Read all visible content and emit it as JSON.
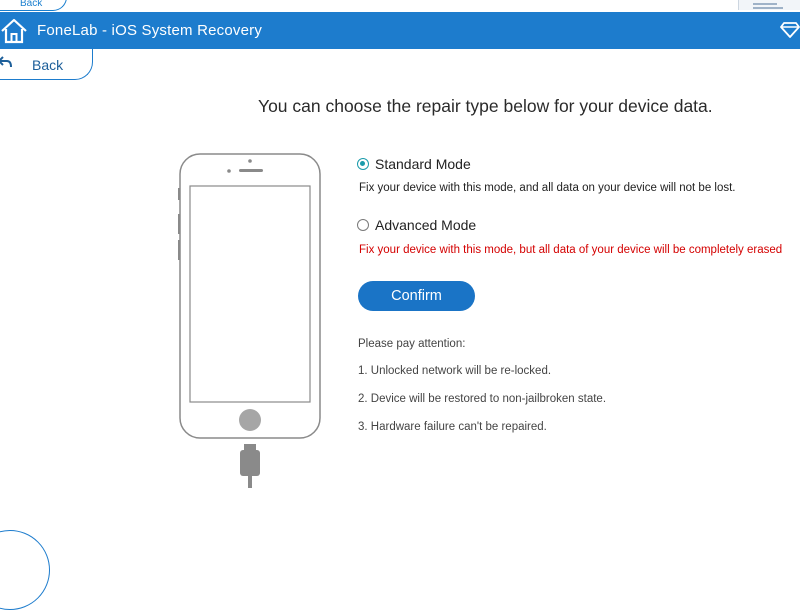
{
  "ghost": {
    "back_label": "Back"
  },
  "titlebar": {
    "title": "FoneLab - iOS System Recovery"
  },
  "nav": {
    "back_label": "Back"
  },
  "heading": "You can choose the repair type below for your device data.",
  "modes": [
    {
      "label": "Standard Mode",
      "selected": true,
      "description": "Fix your device with this mode, and all data on your device will not be lost."
    },
    {
      "label": "Advanced Mode",
      "selected": false,
      "description": "Fix your device with this mode, but all data of your device will be completely erased"
    }
  ],
  "confirm_label": "Confirm",
  "attention": {
    "title": "Please pay attention:",
    "items": [
      "1. Unlocked network will be re-locked.",
      "2. Device will be restored to non-jailbroken state.",
      "3. Hardware failure can't be repaired."
    ]
  },
  "colors": {
    "accent": "#1d7ccd",
    "danger": "#d40000",
    "radio_selected": "#1a9bab"
  },
  "icons": {
    "home": "home-icon",
    "diamond": "diamond-icon",
    "back": "back-arrow-icon",
    "device": "phone-illustration"
  }
}
